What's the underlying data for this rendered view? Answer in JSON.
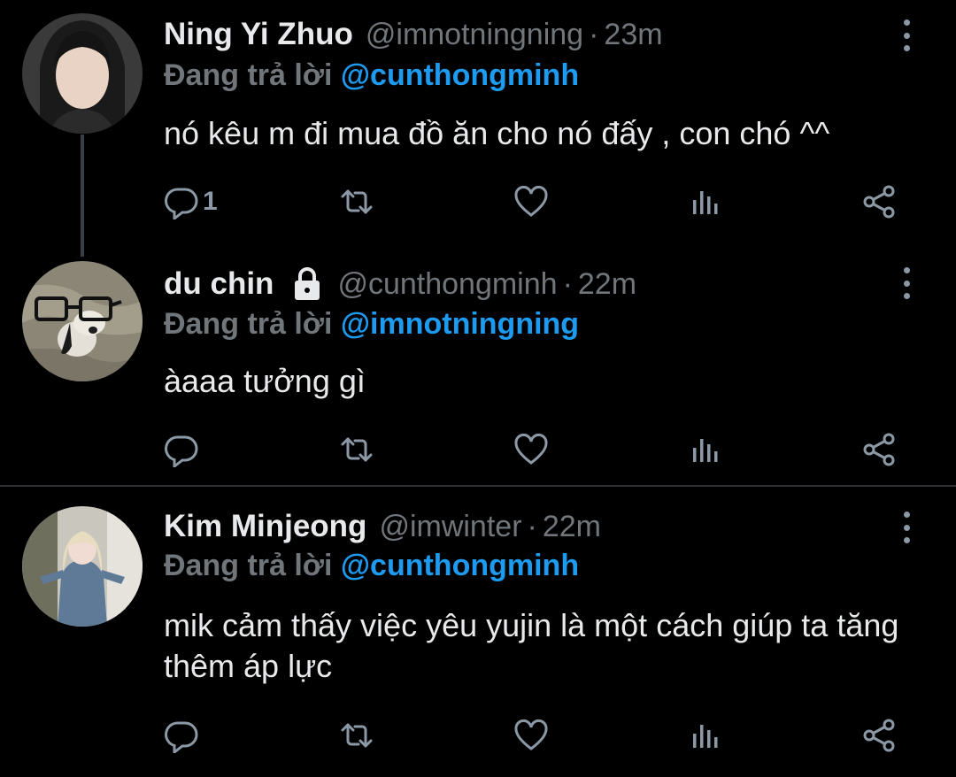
{
  "tweets": [
    {
      "name": "Ning Yi Zhuo",
      "handle": "@imnotningning",
      "time": "23m",
      "dot": "·",
      "replying_prefix": "Đang trả lời",
      "replying_to": "@cunthongminh",
      "text": "nó kêu m đi mua đồ ăn cho nó đấy , con chó ^^",
      "reply_count": "1",
      "locked": false
    },
    {
      "name": "du chin",
      "handle": "@cunthongminh",
      "time": "22m",
      "dot": "·",
      "replying_prefix": "Đang trả lời",
      "replying_to": "@imnotningning",
      "text": "àaaa tưởng gì",
      "reply_count": "",
      "locked": true
    },
    {
      "name": "Kim Minjeong",
      "handle": "@imwinter",
      "time": "22m",
      "dot": "·",
      "replying_prefix": "Đang trả lời",
      "replying_to": "@cunthongminh",
      "text": "mik cảm thấy việc yêu yujin là một cách giúp ta tăng thêm áp lực",
      "reply_count": "",
      "locked": false
    }
  ],
  "icons": {
    "reply": "reply-icon",
    "retweet": "retweet-icon",
    "like": "heart-icon",
    "views": "views-icon",
    "share": "share-icon",
    "more": "more-vertical-icon",
    "lock": "lock-icon"
  },
  "colors": {
    "background": "#000000",
    "text": "#e7e9ea",
    "muted": "#71767b",
    "mention": "#1d9bf0",
    "icon": "#8b98a5",
    "divider": "#2f3336"
  }
}
